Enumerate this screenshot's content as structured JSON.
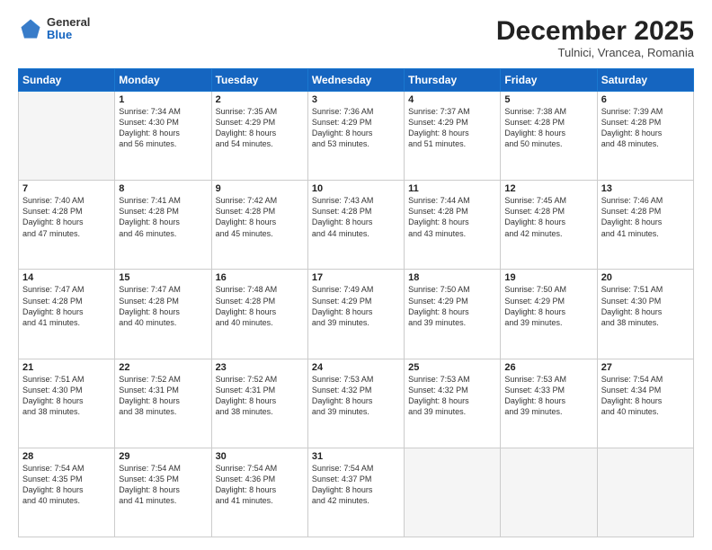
{
  "logo": {
    "general": "General",
    "blue": "Blue"
  },
  "header": {
    "month": "December 2025",
    "location": "Tulnici, Vrancea, Romania"
  },
  "weekdays": [
    "Sunday",
    "Monday",
    "Tuesday",
    "Wednesday",
    "Thursday",
    "Friday",
    "Saturday"
  ],
  "weeks": [
    [
      {
        "day": "",
        "info": ""
      },
      {
        "day": "1",
        "info": "Sunrise: 7:34 AM\nSunset: 4:30 PM\nDaylight: 8 hours\nand 56 minutes."
      },
      {
        "day": "2",
        "info": "Sunrise: 7:35 AM\nSunset: 4:29 PM\nDaylight: 8 hours\nand 54 minutes."
      },
      {
        "day": "3",
        "info": "Sunrise: 7:36 AM\nSunset: 4:29 PM\nDaylight: 8 hours\nand 53 minutes."
      },
      {
        "day": "4",
        "info": "Sunrise: 7:37 AM\nSunset: 4:29 PM\nDaylight: 8 hours\nand 51 minutes."
      },
      {
        "day": "5",
        "info": "Sunrise: 7:38 AM\nSunset: 4:28 PM\nDaylight: 8 hours\nand 50 minutes."
      },
      {
        "day": "6",
        "info": "Sunrise: 7:39 AM\nSunset: 4:28 PM\nDaylight: 8 hours\nand 48 minutes."
      }
    ],
    [
      {
        "day": "7",
        "info": "Sunrise: 7:40 AM\nSunset: 4:28 PM\nDaylight: 8 hours\nand 47 minutes."
      },
      {
        "day": "8",
        "info": "Sunrise: 7:41 AM\nSunset: 4:28 PM\nDaylight: 8 hours\nand 46 minutes."
      },
      {
        "day": "9",
        "info": "Sunrise: 7:42 AM\nSunset: 4:28 PM\nDaylight: 8 hours\nand 45 minutes."
      },
      {
        "day": "10",
        "info": "Sunrise: 7:43 AM\nSunset: 4:28 PM\nDaylight: 8 hours\nand 44 minutes."
      },
      {
        "day": "11",
        "info": "Sunrise: 7:44 AM\nSunset: 4:28 PM\nDaylight: 8 hours\nand 43 minutes."
      },
      {
        "day": "12",
        "info": "Sunrise: 7:45 AM\nSunset: 4:28 PM\nDaylight: 8 hours\nand 42 minutes."
      },
      {
        "day": "13",
        "info": "Sunrise: 7:46 AM\nSunset: 4:28 PM\nDaylight: 8 hours\nand 41 minutes."
      }
    ],
    [
      {
        "day": "14",
        "info": "Sunrise: 7:47 AM\nSunset: 4:28 PM\nDaylight: 8 hours\nand 41 minutes."
      },
      {
        "day": "15",
        "info": "Sunrise: 7:47 AM\nSunset: 4:28 PM\nDaylight: 8 hours\nand 40 minutes."
      },
      {
        "day": "16",
        "info": "Sunrise: 7:48 AM\nSunset: 4:28 PM\nDaylight: 8 hours\nand 40 minutes."
      },
      {
        "day": "17",
        "info": "Sunrise: 7:49 AM\nSunset: 4:29 PM\nDaylight: 8 hours\nand 39 minutes."
      },
      {
        "day": "18",
        "info": "Sunrise: 7:50 AM\nSunset: 4:29 PM\nDaylight: 8 hours\nand 39 minutes."
      },
      {
        "day": "19",
        "info": "Sunrise: 7:50 AM\nSunset: 4:29 PM\nDaylight: 8 hours\nand 39 minutes."
      },
      {
        "day": "20",
        "info": "Sunrise: 7:51 AM\nSunset: 4:30 PM\nDaylight: 8 hours\nand 38 minutes."
      }
    ],
    [
      {
        "day": "21",
        "info": "Sunrise: 7:51 AM\nSunset: 4:30 PM\nDaylight: 8 hours\nand 38 minutes."
      },
      {
        "day": "22",
        "info": "Sunrise: 7:52 AM\nSunset: 4:31 PM\nDaylight: 8 hours\nand 38 minutes."
      },
      {
        "day": "23",
        "info": "Sunrise: 7:52 AM\nSunset: 4:31 PM\nDaylight: 8 hours\nand 38 minutes."
      },
      {
        "day": "24",
        "info": "Sunrise: 7:53 AM\nSunset: 4:32 PM\nDaylight: 8 hours\nand 39 minutes."
      },
      {
        "day": "25",
        "info": "Sunrise: 7:53 AM\nSunset: 4:32 PM\nDaylight: 8 hours\nand 39 minutes."
      },
      {
        "day": "26",
        "info": "Sunrise: 7:53 AM\nSunset: 4:33 PM\nDaylight: 8 hours\nand 39 minutes."
      },
      {
        "day": "27",
        "info": "Sunrise: 7:54 AM\nSunset: 4:34 PM\nDaylight: 8 hours\nand 40 minutes."
      }
    ],
    [
      {
        "day": "28",
        "info": "Sunrise: 7:54 AM\nSunset: 4:35 PM\nDaylight: 8 hours\nand 40 minutes."
      },
      {
        "day": "29",
        "info": "Sunrise: 7:54 AM\nSunset: 4:35 PM\nDaylight: 8 hours\nand 41 minutes."
      },
      {
        "day": "30",
        "info": "Sunrise: 7:54 AM\nSunset: 4:36 PM\nDaylight: 8 hours\nand 41 minutes."
      },
      {
        "day": "31",
        "info": "Sunrise: 7:54 AM\nSunset: 4:37 PM\nDaylight: 8 hours\nand 42 minutes."
      },
      {
        "day": "",
        "info": ""
      },
      {
        "day": "",
        "info": ""
      },
      {
        "day": "",
        "info": ""
      }
    ]
  ]
}
